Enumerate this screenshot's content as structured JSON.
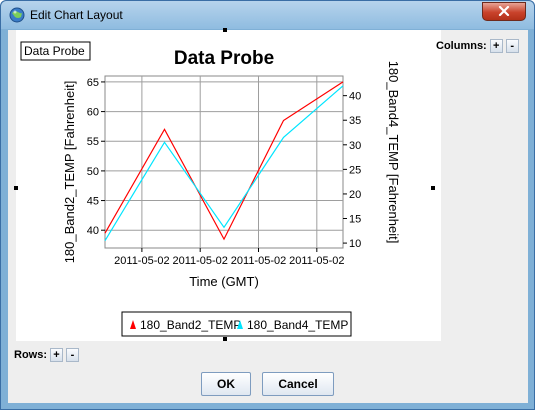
{
  "window": {
    "title": "Edit Chart Layout",
    "close_label": "×"
  },
  "chart_panel": {
    "badge_label": "Data Probe",
    "columns_label": "Columns:",
    "rows_label": "Rows:",
    "add_label": "+",
    "remove_label": "-"
  },
  "buttons": {
    "ok": "OK",
    "cancel": "Cancel"
  },
  "chart_data": {
    "type": "line",
    "title": "Data Probe",
    "xlabel": "Time (GMT)",
    "ylabel_left": "180_Band2_TEMP [Fahrenheit]",
    "ylabel_right": "180_Band4_TEMP [Fahrenheit]",
    "x_tick_labels": [
      "2011-05-02",
      "2011-05-02",
      "2011-05-02",
      "2011-05-02"
    ],
    "x": [
      0,
      0.5,
      1,
      1.5,
      2
    ],
    "xlim": [
      0,
      2
    ],
    "ylim_left": [
      37,
      66
    ],
    "yticks_left": [
      40,
      45,
      50,
      55,
      60,
      65
    ],
    "ylim_right": [
      9,
      44
    ],
    "yticks_right": [
      10,
      15,
      20,
      25,
      30,
      35,
      40
    ],
    "grid": true,
    "legend_position": "bottom",
    "series": [
      {
        "name": "180_Band2_TEMP",
        "axis": "left",
        "color": "#ff0000",
        "values": [
          39.5,
          57,
          38.5,
          58.5,
          65
        ]
      },
      {
        "name": "180_Band4_TEMP",
        "axis": "right",
        "color": "#00e5ff",
        "values": [
          10.5,
          30.5,
          13.2,
          31.5,
          42
        ]
      }
    ]
  }
}
